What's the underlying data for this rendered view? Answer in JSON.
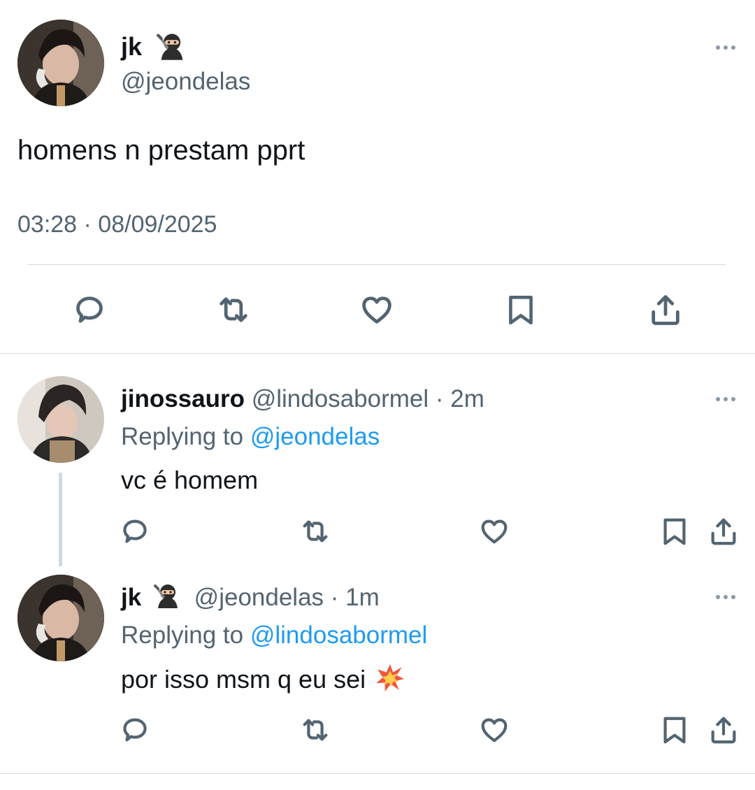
{
  "main_tweet": {
    "display_name": "jk",
    "name_emoji": "ninja-emoji",
    "handle": "@jeondelas",
    "text": "homens n prestam pprt",
    "timestamp": "03:28 · 08/09/2025",
    "actions": [
      "reply-icon",
      "retweet-icon",
      "like-icon",
      "bookmark-icon",
      "share-icon"
    ]
  },
  "replies": [
    {
      "display_name": "jinossauro",
      "handle": "@lindosabormel",
      "time": "· 2m",
      "replying_prefix": "Replying to",
      "replying_to": "@jeondelas",
      "text": "vc é homem"
    },
    {
      "display_name": "jk",
      "name_emoji": "ninja-emoji",
      "handle": "@jeondelas",
      "time": "· 1m",
      "replying_prefix": "Replying to",
      "replying_to": "@lindosabormel",
      "text": "por isso msm q eu sei",
      "text_emoji": "collision-emoji"
    }
  ],
  "colors": {
    "text": "#0f1419",
    "secondary": "#536471",
    "link": "#1d9bf0",
    "divider": "#cfd9de",
    "thread_line": "#cfd9de"
  }
}
